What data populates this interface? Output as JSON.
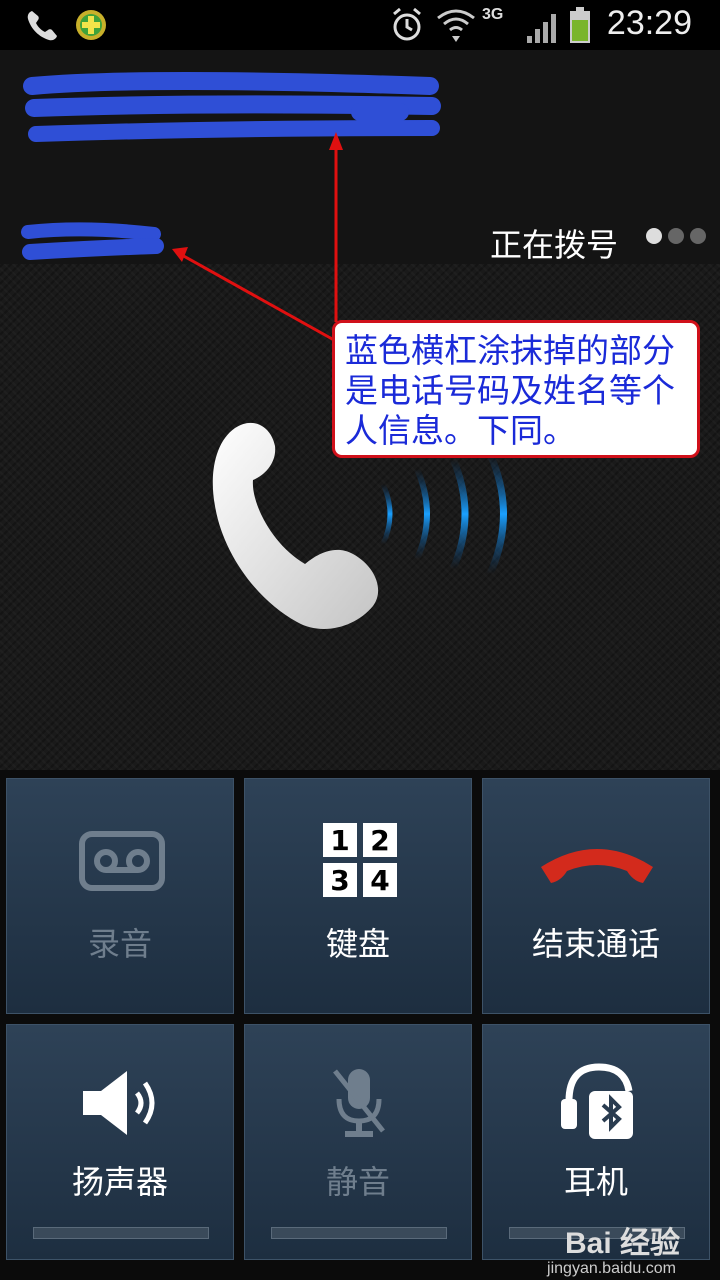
{
  "statusbar": {
    "time": "23:29",
    "network": "3G"
  },
  "call": {
    "status_text": "正在拨号"
  },
  "annotation": {
    "text": "蓝色横杠涂抹掉的部分是电话号码及姓名等个人信息。下同。"
  },
  "controls": {
    "record": {
      "label": "录音"
    },
    "keypad": {
      "label": "键盘",
      "keys": [
        "1",
        "2",
        "3",
        "4"
      ]
    },
    "end_call": {
      "label": "结束通话"
    },
    "speaker": {
      "label": "扬声器"
    },
    "mute": {
      "label": "静音"
    },
    "headset": {
      "label": "耳机"
    }
  },
  "watermark": {
    "brand": "Bai 经验",
    "url": "jingyan.baidu.com"
  },
  "colors": {
    "redaction": "#2f4fd6",
    "annotation_border": "#d0101a",
    "annotation_text": "#1a2ad8",
    "end_call": "#d32a1c",
    "button_bg": "#243649"
  }
}
